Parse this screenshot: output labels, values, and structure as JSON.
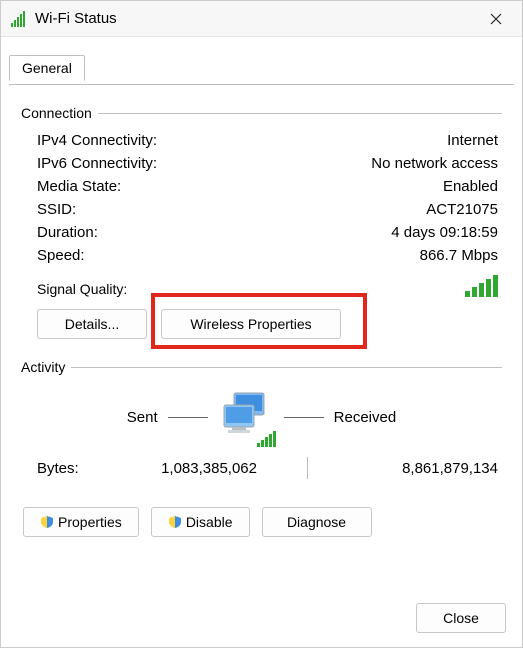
{
  "window": {
    "title": "Wi-Fi Status"
  },
  "tabs": {
    "general": "General"
  },
  "groups": {
    "connection": "Connection",
    "activity": "Activity"
  },
  "connection": {
    "ipv4_label": "IPv4 Connectivity:",
    "ipv4_value": "Internet",
    "ipv6_label": "IPv6 Connectivity:",
    "ipv6_value": "No network access",
    "media_label": "Media State:",
    "media_value": "Enabled",
    "ssid_label": "SSID:",
    "ssid_value": "ACT21075",
    "duration_label": "Duration:",
    "duration_value": "4 days 09:18:59",
    "speed_label": "Speed:",
    "speed_value": "866.7 Mbps",
    "signal_label": "Signal Quality:"
  },
  "buttons": {
    "details": "Details...",
    "wireless_properties": "Wireless Properties",
    "properties": "Properties",
    "disable": "Disable",
    "diagnose": "Diagnose",
    "close": "Close"
  },
  "activity": {
    "sent_label": "Sent",
    "received_label": "Received",
    "bytes_label": "Bytes:",
    "sent_value": "1,083,385,062",
    "received_value": "8,861,879,134"
  }
}
